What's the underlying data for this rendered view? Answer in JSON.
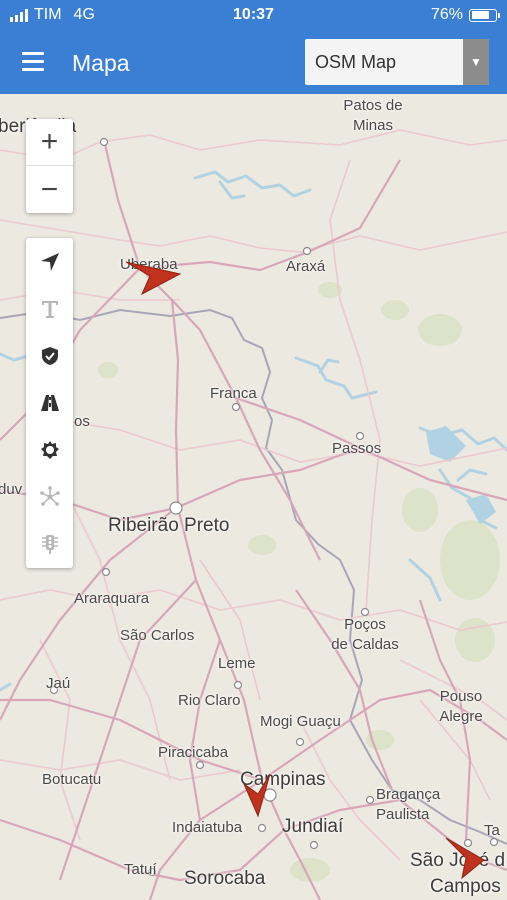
{
  "status": {
    "carrier": "TIM",
    "network": "4G",
    "time": "10:37",
    "battery": "76%",
    "battery_level": 0.76
  },
  "header": {
    "menu_icon": "hamburger-icon",
    "title": "Mapa",
    "layer_value": "OSM Map",
    "layer_arrow": "▼"
  },
  "zoom": {
    "in_label": "+",
    "out_label": "−"
  },
  "tools": [
    {
      "name": "locate-icon",
      "enabled": true
    },
    {
      "name": "text-icon",
      "enabled": false
    },
    {
      "name": "shield-icon",
      "enabled": true
    },
    {
      "name": "road-icon",
      "enabled": true
    },
    {
      "name": "gear-icon",
      "enabled": true
    },
    {
      "name": "network-icon",
      "enabled": false
    },
    {
      "name": "traffic-light-icon",
      "enabled": false
    }
  ],
  "places": {
    "uberlandia": "berlândia",
    "patos": "Patos de",
    "minas": "Minas",
    "uberaba": "Uberaba",
    "araxa": "Araxá",
    "franca": "Franca",
    "frutal": "os",
    "passos": "Passos",
    "duv": "duv",
    "ribeirao": "Ribeirão Preto",
    "araraquara": "Araraquara",
    "sao_carlos": "São Carlos",
    "pocos1": "Poços",
    "pocos2": "de Caldas",
    "leme": "Leme",
    "jau": "Jaú",
    "rio_claro": "Rio Claro",
    "mogi": "Mogi Guaçu",
    "pouso1": "Pouso",
    "pouso2": "Alegre",
    "piracicaba": "Piracicaba",
    "campinas": "Campinas",
    "botucatu": "Botucatu",
    "braganca1": "Bragança",
    "braganca2": "Paulista",
    "indaiatuba": "Indaiatuba",
    "jundiai": "Jundiaí",
    "sjc": "São José d",
    "ta": "Ta",
    "tatui": "Tatuí",
    "sorocaba": "Sorocaba",
    "campos": "Campos"
  },
  "colors": {
    "header": "#3b7fd4",
    "marker": "#c0311e",
    "water": "#aad3df",
    "road": "#d8a6b8"
  }
}
